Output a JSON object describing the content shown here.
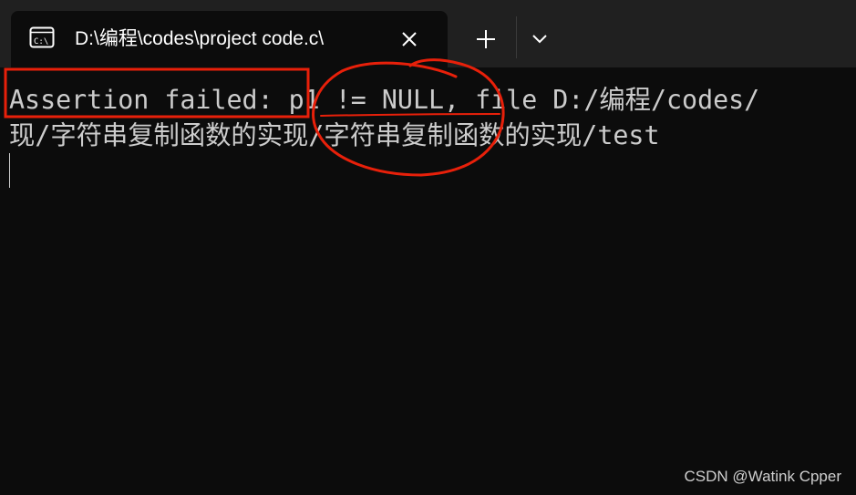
{
  "tab": {
    "title": "D:\\编程\\codes\\project code.c\\",
    "icon": "terminal-icon",
    "close_icon": "close-icon"
  },
  "toolbar": {
    "new_tab_icon": "plus-icon",
    "dropdown_icon": "chevron-down-icon"
  },
  "terminal": {
    "lines": [
      "Assertion failed: p1 != NULL, file D:/编程/codes/",
      "现/字符串复制函数的实现/字符串复制函数的实现/test"
    ],
    "text_color": "#cccccc",
    "background": "#0c0c0c"
  },
  "annotations": {
    "color": "#e8200a"
  },
  "watermark": "CSDN @Watink Cpper"
}
